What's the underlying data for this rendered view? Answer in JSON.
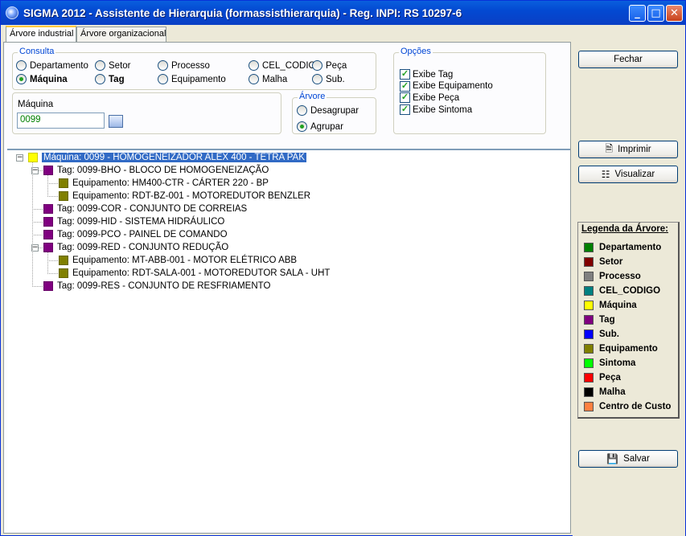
{
  "window": {
    "title": "SIGMA 2012 - Assistente de Hierarquia  (formassisthierarquia)  - Reg. INPI: RS 10297-6",
    "min": "_",
    "max": "□",
    "close": "✕"
  },
  "tabs": [
    {
      "label": "Árvore industrial"
    },
    {
      "label": "Árvore organizacional"
    }
  ],
  "consulta": {
    "legend": "Consulta",
    "options": [
      {
        "label": "Departamento",
        "selected": false
      },
      {
        "label": "Setor",
        "selected": false
      },
      {
        "label": "Processo",
        "selected": false
      },
      {
        "label": "CEL_CODIG",
        "selected": false
      },
      {
        "label": "Peça",
        "selected": false
      },
      {
        "label": "Máquina",
        "selected": true
      },
      {
        "label": "Tag",
        "selected": false
      },
      {
        "label": "Equipamento",
        "selected": false
      },
      {
        "label": "Malha",
        "selected": false
      },
      {
        "label": "Sub.",
        "selected": false
      }
    ]
  },
  "maquina": {
    "label": "Máquina",
    "value": "0099"
  },
  "arvore": {
    "legend": "Árvore",
    "options": [
      {
        "label": "Desagrupar",
        "selected": false
      },
      {
        "label": "Agrupar",
        "selected": true
      }
    ]
  },
  "opcoes": {
    "legend": "Opções",
    "items": [
      {
        "label": "Exibe Tag",
        "checked": true
      },
      {
        "label": "Exibe Equipamento",
        "checked": true
      },
      {
        "label": "Exibe Peça",
        "checked": true
      },
      {
        "label": "Exibe Sintoma",
        "checked": true
      }
    ]
  },
  "tree": [
    {
      "text": "Máquina: 0099 - HOMOGENEIZADOR ALEX 400 - TETRA PAK",
      "color": "#ffff00",
      "selected": true
    },
    {
      "text": "Tag: 0099-BHO - BLOCO DE HOMOGENEIZAÇÃO",
      "color": "#800080"
    },
    {
      "text": "Equipamento: HM400-CTR - CÁRTER 220 - BP",
      "color": "#808000"
    },
    {
      "text": "Equipamento: RDT-BZ-001 - MOTOREDUTOR BENZLER",
      "color": "#808000"
    },
    {
      "text": "Tag: 0099-COR - CONJUNTO DE CORREIAS",
      "color": "#800080"
    },
    {
      "text": "Tag: 0099-HID - SISTEMA HIDRÁULICO",
      "color": "#800080"
    },
    {
      "text": "Tag: 0099-PCO - PAINEL DE COMANDO",
      "color": "#800080"
    },
    {
      "text": "Tag: 0099-RED - CONJUNTO REDUÇÃO",
      "color": "#800080"
    },
    {
      "text": "Equipamento: MT-ABB-001 - MOTOR ELÉTRICO ABB",
      "color": "#808000"
    },
    {
      "text": "Equipamento: RDT-SALA-001 - MOTOREDUTOR SALA - UHT",
      "color": "#808000"
    },
    {
      "text": "Tag: 0099-RES - CONJUNTO DE RESFRIAMENTO",
      "color": "#800080"
    }
  ],
  "buttons": {
    "fechar": "Fechar",
    "imprimir": "Imprimir",
    "visualizar": "Visualizar",
    "salvar": "Salvar"
  },
  "legenda": {
    "title": "Legenda da Árvore:",
    "items": [
      {
        "label": "Departamento",
        "color": "#008000"
      },
      {
        "label": "Setor",
        "color": "#800000"
      },
      {
        "label": "Processo",
        "color": "#808080"
      },
      {
        "label": "CEL_CODIGO",
        "color": "#008080"
      },
      {
        "label": "Máquina",
        "color": "#ffff00"
      },
      {
        "label": "Tag",
        "color": "#800080"
      },
      {
        "label": "Sub.",
        "color": "#0000ff"
      },
      {
        "label": "Equipamento",
        "color": "#808000"
      },
      {
        "label": "Sintoma",
        "color": "#00ff00"
      },
      {
        "label": "Peça",
        "color": "#ff0000"
      },
      {
        "label": "Malha",
        "color": "#000000"
      },
      {
        "label": "Centro de Custo",
        "color": "#ff8040"
      }
    ]
  }
}
